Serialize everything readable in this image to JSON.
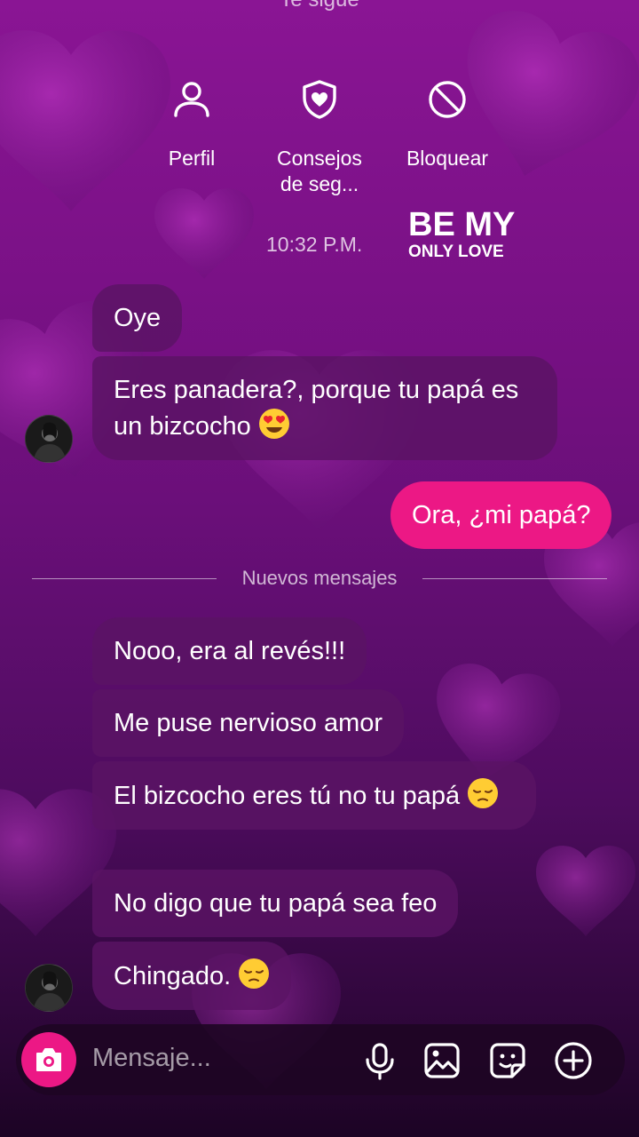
{
  "header": {
    "cut_text": "Te sigue"
  },
  "actions": [
    {
      "label": "Perfil",
      "icon": "profile-icon"
    },
    {
      "label": "Consejos de seg...",
      "icon": "shield-heart-icon"
    },
    {
      "label": "Bloquear",
      "icon": "block-icon"
    }
  ],
  "timestamp": "10:32 P.M.",
  "sticker": {
    "line1": "BE MY",
    "line2": "ONLY LOVE"
  },
  "messages": [
    {
      "text": "Oye",
      "direction": "in"
    },
    {
      "text": "Eres panadera?, porque tu papá es un bizcocho",
      "emoji": "heart-eyes-emoji",
      "direction": "in"
    },
    {
      "text": "Ora, ¿mi papá?",
      "direction": "out"
    },
    {
      "text": "Nooo, era al revés!!!",
      "direction": "in"
    },
    {
      "text": "Me puse nervioso amor",
      "direction": "in"
    },
    {
      "text": "El bizcocho eres tú no tu papá",
      "emoji": "pensive-emoji",
      "direction": "in"
    },
    {
      "text": "No digo que tu papá sea feo",
      "direction": "in"
    },
    {
      "text": "Chingado.",
      "emoji": "pensive-emoji",
      "direction": "in"
    }
  ],
  "divider_label": "Nuevos mensajes",
  "composer": {
    "placeholder": "Mensaje...",
    "icons": [
      "camera-icon",
      "microphone-icon",
      "gallery-icon",
      "sticker-icon",
      "plus-icon"
    ]
  },
  "colors": {
    "accent": "#ec1885",
    "incoming_bubble": "#5a1464",
    "background_top": "#8a1594",
    "background_bottom": "#1c0424"
  }
}
